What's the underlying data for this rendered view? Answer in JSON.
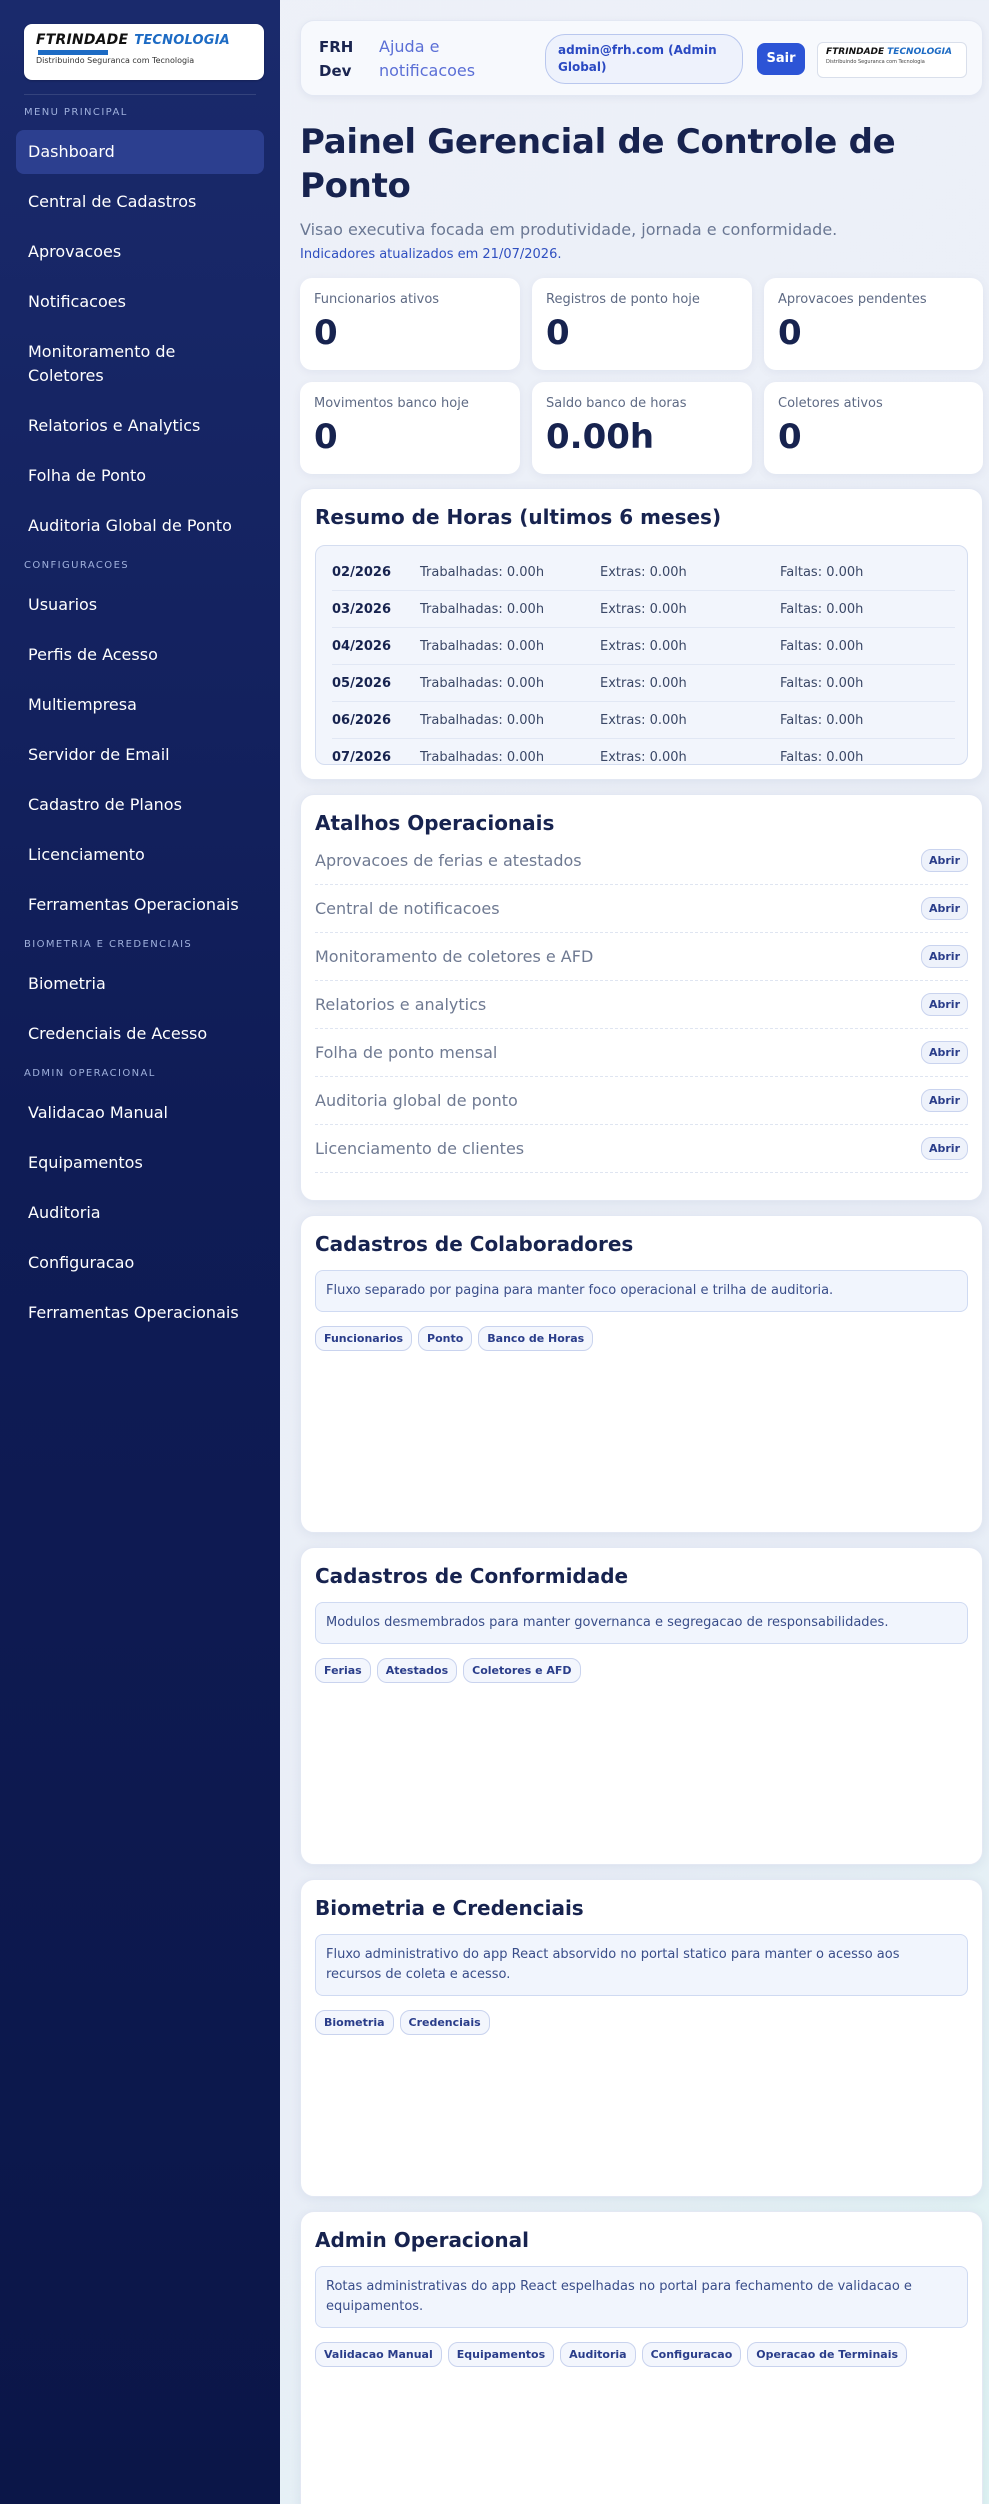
{
  "sidebar": {
    "logo": {
      "name": "FTRINDADE",
      "tech": "TECNOLOGIA",
      "tagline": "Distribuindo Seguranca com Tecnologia"
    },
    "sections": [
      {
        "title": "MENU PRINCIPAL",
        "items": [
          "Dashboard",
          "Central de Cadastros",
          "Aprovacoes",
          "Notificacoes",
          "Monitoramento de Coletores",
          "Relatorios e Analytics",
          "Folha de Ponto",
          "Auditoria Global de Ponto"
        ]
      },
      {
        "title": "CONFIGURACOES",
        "items": [
          "Usuarios",
          "Perfis de Acesso",
          "Multiempresa",
          "Servidor de Email",
          "Cadastro de Planos",
          "Licenciamento",
          "Ferramentas Operacionais"
        ]
      },
      {
        "title": "BIOMETRIA E CREDENCIAIS",
        "items": [
          "Biometria",
          "Credenciais de Acesso"
        ]
      },
      {
        "title": "ADMIN OPERACIONAL",
        "items": [
          "Validacao Manual",
          "Equipamentos",
          "Auditoria",
          "Configuracao",
          "Ferramentas Operacionais"
        ]
      }
    ],
    "active_item": "Dashboard"
  },
  "topbar": {
    "brand": "FRH Dev",
    "help": "Ajuda e notificacoes",
    "user": "admin@frh.com (Admin Global)",
    "logout": "Sair",
    "mini_logo": {
      "name": "FTRINDADE",
      "tech": "TECNOLOGIA",
      "tagline": "Distribuindo Seguranca com Tecnologia"
    }
  },
  "header": {
    "title": "Painel Gerencial de Controle de Ponto",
    "subtitle": "Visao executiva focada em produtividade, jornada e conformidade.",
    "updated": "Indicadores atualizados em 21/07/2026."
  },
  "kpis": [
    {
      "label": "Funcionarios ativos",
      "value": "0"
    },
    {
      "label": "Registros de ponto hoje",
      "value": "0"
    },
    {
      "label": "Aprovacoes pendentes",
      "value": "0"
    },
    {
      "label": "Movimentos banco hoje",
      "value": "0"
    },
    {
      "label": "Saldo banco de horas",
      "value": "0.00h"
    },
    {
      "label": "Coletores ativos",
      "value": "0"
    }
  ],
  "hours_summary": {
    "title": "Resumo de Horas (ultimos 6 meses)",
    "rows": [
      {
        "month": "02/2026",
        "worked": "Trabalhadas: 0.00h",
        "extra": "Extras: 0.00h",
        "absent": "Faltas: 0.00h"
      },
      {
        "month": "03/2026",
        "worked": "Trabalhadas: 0.00h",
        "extra": "Extras: 0.00h",
        "absent": "Faltas: 0.00h"
      },
      {
        "month": "04/2026",
        "worked": "Trabalhadas: 0.00h",
        "extra": "Extras: 0.00h",
        "absent": "Faltas: 0.00h"
      },
      {
        "month": "05/2026",
        "worked": "Trabalhadas: 0.00h",
        "extra": "Extras: 0.00h",
        "absent": "Faltas: 0.00h"
      },
      {
        "month": "06/2026",
        "worked": "Trabalhadas: 0.00h",
        "extra": "Extras: 0.00h",
        "absent": "Faltas: 0.00h"
      },
      {
        "month": "07/2026",
        "worked": "Trabalhadas: 0.00h",
        "extra": "Extras: 0.00h",
        "absent": "Faltas: 0.00h"
      }
    ]
  },
  "shortcuts": {
    "title": "Atalhos Operacionais",
    "open_label": "Abrir",
    "items": [
      "Aprovacoes de ferias e atestados",
      "Central de notificacoes",
      "Monitoramento de coletores e AFD",
      "Relatorios e analytics",
      "Folha de ponto mensal",
      "Auditoria global de ponto",
      "Licenciamento de clientes"
    ]
  },
  "modules": [
    {
      "title": "Cadastros de Colaboradores",
      "info": "Fluxo separado por pagina para manter foco operacional e trilha de auditoria.",
      "tags": [
        "Funcionarios",
        "Ponto",
        "Banco de Horas"
      ]
    },
    {
      "title": "Cadastros de Conformidade",
      "info": "Modulos desmembrados para manter governanca e segregacao de responsabilidades.",
      "tags": [
        "Ferias",
        "Atestados",
        "Coletores e AFD"
      ]
    },
    {
      "title": "Biometria e Credenciais",
      "info": "Fluxo administrativo do app React absorvido no portal statico para manter o acesso aos recursos de coleta e acesso.",
      "tags": [
        "Biometria",
        "Credenciais"
      ]
    },
    {
      "title": "Admin Operacional",
      "info": "Rotas administrativas do app React espelhadas no portal para fechamento de validacao e equipamentos.",
      "tags": [
        "Validacao Manual",
        "Equipamentos",
        "Auditoria",
        "Configuracao",
        "Operacao de Terminais"
      ]
    }
  ]
}
